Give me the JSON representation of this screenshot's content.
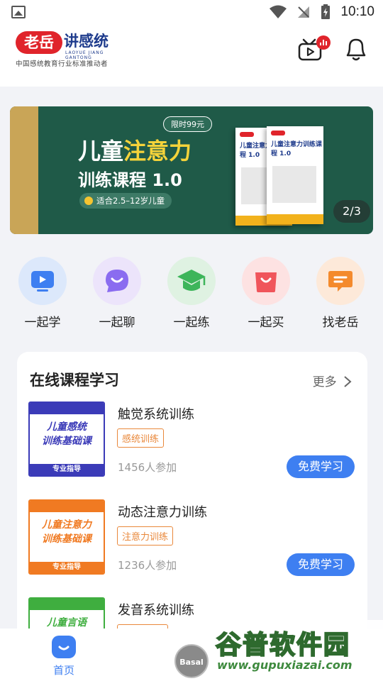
{
  "status_bar": {
    "time": "10:10"
  },
  "header": {
    "logo_badge": "老岳",
    "logo_name": "讲感统",
    "logo_en": "LAOYUE JIANG GANTONG",
    "logo_subtitle": "中国感统教育行业标准推动者",
    "notif_badge": "ıl"
  },
  "banner": {
    "tag": "限时99元",
    "title_prefix": "儿童",
    "title_highlight": "注意力",
    "title_line2": "训练课程 1.0",
    "age": "适合2.5–12岁儿童",
    "book_title": "儿童注意力训练课程 1.0",
    "counter": "2/3"
  },
  "quick_menu": [
    {
      "label": "一起学",
      "icon": "play-screen-icon",
      "color": "#dce8fb",
      "inner": "#3e7ff1"
    },
    {
      "label": "一起聊",
      "icon": "chat-bubble-icon",
      "color": "#ece4fb",
      "inner": "#8a6cf0"
    },
    {
      "label": "一起练",
      "icon": "graduation-cap-icon",
      "color": "#dff2e2",
      "inner": "#3db55a"
    },
    {
      "label": "一起买",
      "icon": "shopping-bag-icon",
      "color": "#fde2e2",
      "inner": "#f0555b"
    },
    {
      "label": "找老岳",
      "icon": "message-icon",
      "color": "#fde9d9",
      "inner": "#f48a2c"
    }
  ],
  "courses_section": {
    "title": "在线课程学习",
    "more": "更多",
    "courses": [
      {
        "name": "触觉系统训练",
        "tag": "感统训练",
        "count": "1456人参加",
        "button": "免费学习",
        "cover_lines": [
          "儿童感统",
          "训练基础课"
        ],
        "cover_foot": "专业指导",
        "cover_color": "#3b3bb8"
      },
      {
        "name": "动态注意力训练",
        "tag": "注意力训练",
        "count": "1236人参加",
        "button": "免费学习",
        "cover_lines": [
          "儿童注意力",
          "训练基础课"
        ],
        "cover_foot": "专业指导",
        "cover_color": "#f07a22"
      },
      {
        "name": "发音系统训练",
        "tag": "",
        "count": "",
        "button": "",
        "cover_lines": [
          "儿童言语",
          ""
        ],
        "cover_foot": "",
        "cover_color": "#3fae3f"
      }
    ]
  },
  "tabbar": {
    "home": "首页",
    "basal": "Basal"
  },
  "watermark": {
    "title": "谷普软件园",
    "url": "www.gupuxiazai.com"
  }
}
